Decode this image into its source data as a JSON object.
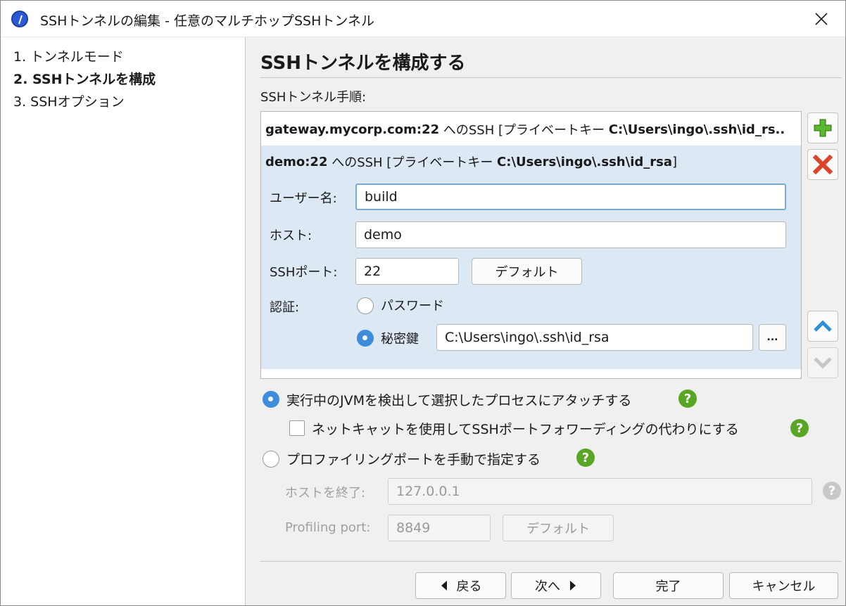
{
  "window": {
    "title": "SSHトンネルの編集 - 任意のマルチホップSSHトンネル",
    "app_icon": "jprofiler-icon",
    "close_icon": "close-icon"
  },
  "steps": [
    {
      "label": "1. トンネルモード",
      "active": false
    },
    {
      "label": "2. SSHトンネルを構成",
      "active": true
    },
    {
      "label": "3. SSHオプション",
      "active": false
    }
  ],
  "main": {
    "heading": "SSHトンネルを構成する",
    "tunnel_section_label": "SSHトンネル手順:",
    "hops": [
      {
        "host": "gateway.mycorp.com:22",
        "middle": " へのSSH [プライベートキー ",
        "key": "C:\\Users\\ingo\\.ssh\\id_rs..",
        "suffix": ""
      },
      {
        "host": "demo:22",
        "middle": " へのSSH [プライベートキー ",
        "key": "C:\\Users\\ingo\\.ssh\\id_rsa",
        "suffix": "]"
      }
    ],
    "editor": {
      "username_label": "ユーザー名:",
      "username_value": "build",
      "host_label": "ホスト:",
      "host_value": "demo",
      "port_label": "SSHポート:",
      "port_value": "22",
      "default_button": "デフォルト",
      "auth_label": "認証:",
      "password_option": "パスワード",
      "private_key_option": "秘密鍵",
      "private_key_path": "C:\\Users\\ingo\\.ssh\\id_rsa",
      "browse_button": "...",
      "selected_auth": "private_key"
    },
    "side_buttons": {
      "add_icon": "plus-icon",
      "remove_icon": "delete-icon",
      "up_icon": "move-up-icon",
      "down_icon": "move-down-icon"
    },
    "attach_option": "実行中のJVMを検出して選択したプロセスにアタッチする",
    "netcat_option": "ネットキャットを使用してSSHポートフォワーディングの代わりにする",
    "manual_option": "プロファイリングポートを手動で指定する",
    "end_host_label": "ホストを終了:",
    "end_host_value": "127.0.0.1",
    "profiling_port_label": "Profiling port:",
    "profiling_port_value": "8849",
    "profiling_default_button": "デフォルト",
    "help_glyph": "?"
  },
  "footer": {
    "back_label": "戻る",
    "next_label": "次へ",
    "finish_label": "完了",
    "cancel_label": "キャンセル"
  },
  "colors": {
    "accent": "#3d8ddb",
    "selection": "#dce9f5",
    "help": "#58a624",
    "delete": "#d9442a"
  }
}
